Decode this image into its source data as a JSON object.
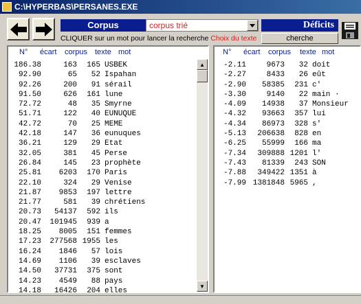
{
  "window": {
    "title": "C:\\HYPERBAS\\PERSANES.EXE"
  },
  "toolbar": {
    "corpus_label": "Corpus",
    "corpus_selected": "corpus trié",
    "deficits_label": "Déficits",
    "instruction_prefix": "CLIQUER sur un mot pour lancer la recherche ",
    "instruction_link": "Choix du texte",
    "search_button": "cherche"
  },
  "columns": {
    "score": "N°",
    "ecart": "écart",
    "corpus": "corpus",
    "texte": "texte",
    "mot": "mot"
  },
  "left_rows": [
    [
      "186.38",
      "163",
      "165",
      "USBEK"
    ],
    [
      "92.90",
      "65",
      "52",
      "Ispahan"
    ],
    [
      "92.26",
      "200",
      "91",
      "sérail"
    ],
    [
      "91.50",
      "626",
      "161",
      "lune"
    ],
    [
      "72.72",
      "48",
      "35",
      "Smyrne"
    ],
    [
      "51.71",
      "122",
      "40",
      "EUNUQUE"
    ],
    [
      "42.72",
      "70",
      "25",
      "MEME"
    ],
    [
      "42.18",
      "147",
      "36",
      "eunuques"
    ],
    [
      "36.21",
      "129",
      "29",
      "Etat"
    ],
    [
      "32.05",
      "381",
      "45",
      "Perse"
    ],
    [
      "26.84",
      "145",
      "23",
      "prophète"
    ],
    [
      "25.81",
      "6203",
      "170",
      "Paris"
    ],
    [
      "22.10",
      "324",
      "29",
      "Venise"
    ],
    [
      "21.87",
      "9853",
      "197",
      "lettre"
    ],
    [
      "21.77",
      "581",
      "39",
      "chrétiens"
    ],
    [
      "20.73",
      "54137",
      "592",
      "ils"
    ],
    [
      "20.47",
      "101945",
      "939",
      "a"
    ],
    [
      "18.25",
      "8005",
      "151",
      "femmes"
    ],
    [
      "17.23",
      "277568",
      "1955",
      "les"
    ],
    [
      "16.24",
      "1846",
      "57",
      "lois"
    ],
    [
      "14.69",
      "1106",
      "39",
      "esclaves"
    ],
    [
      "14.50",
      "37731",
      "375",
      "sont"
    ],
    [
      "14.23",
      "4549",
      "88",
      "pays"
    ],
    [
      "14.18",
      "16426",
      "204",
      "elles"
    ]
  ],
  "right_rows": [
    [
      "-2.11",
      "9673",
      "32",
      "doit"
    ],
    [
      "-2.27",
      "8433",
      "26",
      "eût"
    ],
    [
      "-2.90",
      "58385",
      "231",
      "c'"
    ],
    [
      "-3.30",
      "9140",
      "22",
      "main ·"
    ],
    [
      "-4.09",
      "14938",
      "37",
      "Monsieur"
    ],
    [
      "-4.32",
      "93663",
      "357",
      "lui"
    ],
    [
      "-4.34",
      "86973",
      "328",
      "s'"
    ],
    [
      "-5.13",
      "206638",
      "828",
      "en"
    ],
    [
      "-6.25",
      "55999",
      "166",
      "ma"
    ],
    [
      "-7.34",
      "309888",
      "1201",
      "l'"
    ],
    [
      "-7.43",
      "81339",
      "243",
      "SON"
    ],
    [
      "-7.88",
      "349422",
      "1351",
      "à"
    ],
    [
      "-7.99",
      "1381848",
      "5965",
      ","
    ]
  ]
}
